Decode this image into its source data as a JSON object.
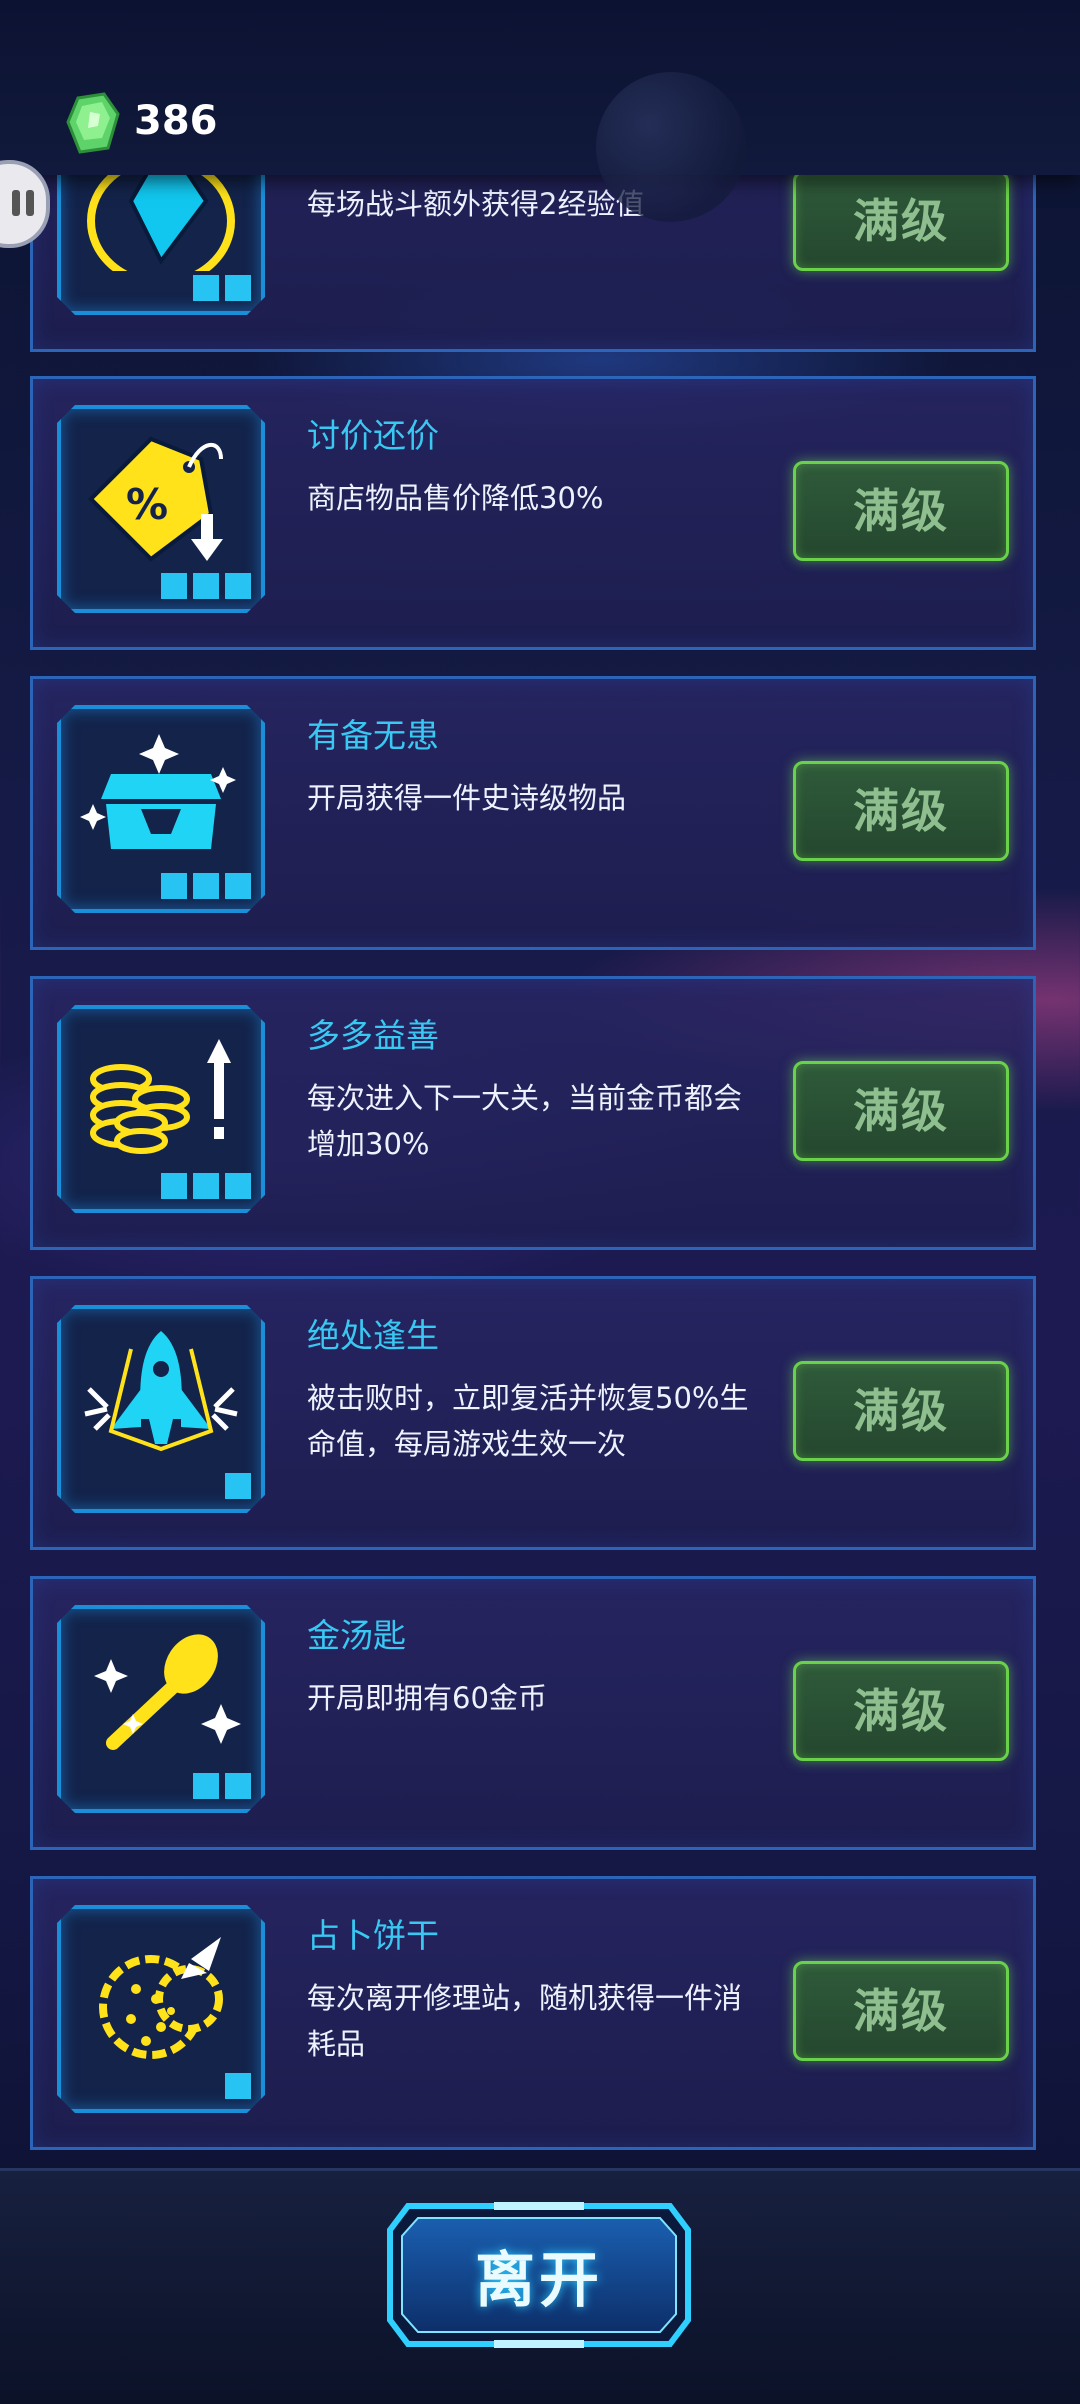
{
  "header": {
    "gem_count": "386"
  },
  "perks": [
    {
      "name": "",
      "description": "每场战斗额外获得2经验值",
      "level": 2,
      "button": "满级",
      "icon": "diamond-icon"
    },
    {
      "name": "讨价还价",
      "description": "商店物品售价降低30%",
      "level": 3,
      "button": "满级",
      "icon": "price-tag-icon"
    },
    {
      "name": "有备无患",
      "description": "开局获得一件史诗级物品",
      "level": 3,
      "button": "满级",
      "icon": "treasure-chest-icon"
    },
    {
      "name": "多多益善",
      "description": "每次进入下一大关，当前金币都会增加30%",
      "level": 3,
      "button": "满级",
      "icon": "coin-stack-icon"
    },
    {
      "name": "绝处逢生",
      "description": "被击败时，立即复活并恢复50%生命值，每局游戏生效一次",
      "level": 1,
      "button": "满级",
      "icon": "rocket-icon"
    },
    {
      "name": "金汤匙",
      "description": "开局即拥有60金币",
      "level": 2,
      "button": "满级",
      "icon": "golden-spoon-icon"
    },
    {
      "name": "占卜饼干",
      "description": "每次离开修理站，随机获得一件消耗品",
      "level": 1,
      "button": "满级",
      "icon": "fortune-cookie-icon"
    }
  ],
  "footer": {
    "leave_label": "离开"
  }
}
